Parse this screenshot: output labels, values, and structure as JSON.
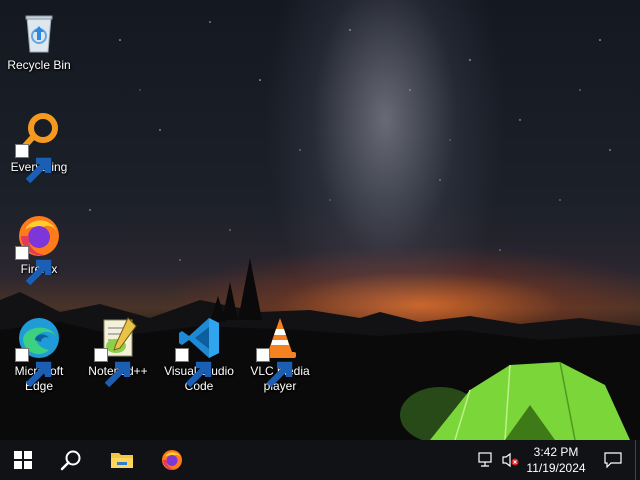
{
  "desktop_icons": [
    {
      "id": "recycle-bin",
      "label": "Recycle Bin",
      "icon": "recycle-bin-icon",
      "shortcut": false
    },
    {
      "id": "everything",
      "label": "Everything",
      "icon": "everything-icon",
      "shortcut": true
    },
    {
      "id": "firefox",
      "label": "Firefox",
      "icon": "firefox-icon",
      "shortcut": true
    },
    {
      "id": "edge",
      "label": "Microsoft Edge",
      "icon": "edge-icon",
      "shortcut": true
    },
    {
      "id": "notepadpp",
      "label": "Notepad++",
      "icon": "notepadpp-icon",
      "shortcut": true
    },
    {
      "id": "vscode",
      "label": "Visual Studio Code",
      "icon": "vscode-icon",
      "shortcut": true
    },
    {
      "id": "vlc",
      "label": "VLC media player",
      "icon": "vlc-icon",
      "shortcut": true
    }
  ],
  "taskbar": {
    "start_icon": "windows-logo-icon",
    "search_icon": "search-icon",
    "pinned": [
      {
        "name": "file-explorer",
        "icon": "folder-icon"
      },
      {
        "name": "firefox",
        "icon": "firefox-icon"
      }
    ],
    "tray": {
      "network_icon": "network-disconnected-icon",
      "volume_icon": "volume-muted-icon",
      "time": "3:42 PM",
      "date": "11/19/2024",
      "notifications_icon": "action-center-icon"
    }
  },
  "colors": {
    "taskbar_bg": "#101215",
    "tent_green": "#7bd63a",
    "horizon_orange": "#e0702c"
  }
}
